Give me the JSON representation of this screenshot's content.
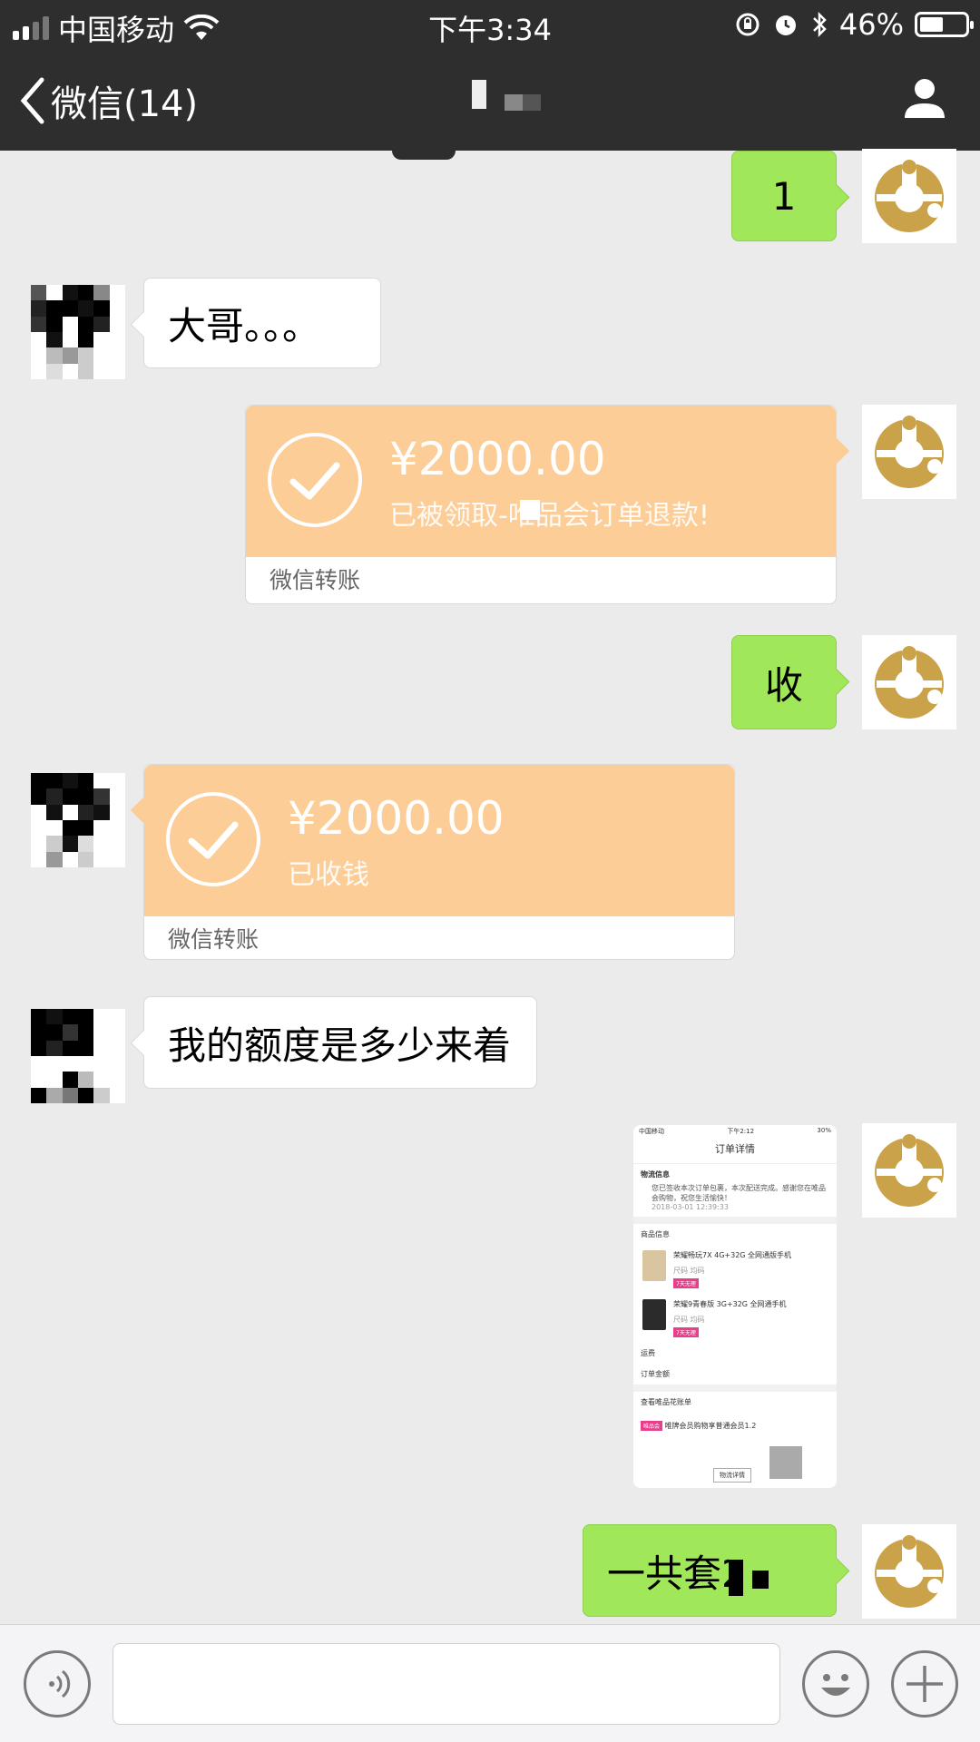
{
  "status_bar": {
    "carrier": "中国移动",
    "time": "下午3:34",
    "battery": "46%",
    "battery_level": 0.46
  },
  "nav": {
    "back_label": "微信(14)",
    "icons": {
      "back": "chevron-left-icon",
      "contact": "person-icon"
    }
  },
  "messages": [
    {
      "side": "right",
      "type": "text",
      "text": "1"
    },
    {
      "side": "left",
      "type": "text",
      "text": "大哥。。。"
    },
    {
      "side": "right",
      "type": "transfer",
      "amount": "¥2000.00",
      "note": "已被领取-唯品会订单退款!",
      "footer": "微信转账"
    },
    {
      "side": "right",
      "type": "text",
      "text": "收"
    },
    {
      "side": "left",
      "type": "transfer",
      "amount": "¥2000.00",
      "note": "已收钱",
      "footer": "微信转账"
    },
    {
      "side": "left",
      "type": "text",
      "text": "我的额度是多少来着"
    },
    {
      "side": "right",
      "type": "image",
      "screenshot": {
        "carrier": "中国移动",
        "time": "下午2:12",
        "battery": "30%",
        "title": "订单详情",
        "logistics_header": "物流信息",
        "logistics_text": "您已签收本次订单包裹，本次配送完成。感谢您在唯品会购物，祝您生活愉快！",
        "logistics_time": "2018-03-01 12:39:33",
        "goods_header": "商品信息",
        "item1": "荣耀畅玩7X 4G+32G 全网通版手机",
        "item2": "荣耀9青春版 3G+32G 全网通手机",
        "item_spec": "尺码 均码",
        "item_tag": "7天无理",
        "shipping": "运费",
        "order_amount": "订单金额",
        "bill_link": "查看唯品花账单",
        "member_tag": "唯品会",
        "member_text": "唯牌会员购物享普通会员1.2",
        "logistics_button": "物流详情"
      }
    },
    {
      "side": "right",
      "type": "text",
      "text": "一共套2.3"
    }
  ],
  "input": {
    "value": "",
    "placeholder": ""
  },
  "icons": {
    "voice": "voice-icon",
    "emoji": "emoji-icon",
    "plus": "plus-icon",
    "check": "check-icon"
  },
  "colors": {
    "nav_bg": "#2e2e2e",
    "chat_bg": "#ebebeb",
    "green_bubble": "#a0e75a",
    "transfer_orange": "#fdcd97",
    "avatar_gold": "#c9a24a"
  }
}
